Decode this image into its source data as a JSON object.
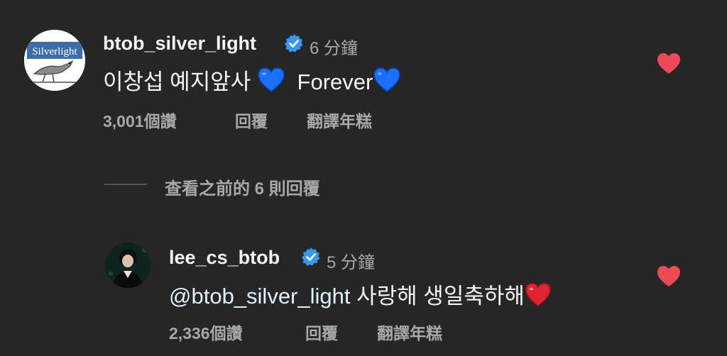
{
  "comment": {
    "avatar_text": "Silverlight",
    "username": "btob_silver_light",
    "time": "6 分鐘",
    "text_part1": "이창섭 예지앞사",
    "text_part2": "Forever",
    "likes": "3,001",
    "likes_label": "個讚",
    "reply_label": "回覆",
    "translate_label": "翻譯年糕",
    "liked": true
  },
  "view_replies": "查看之前的 6 則回覆",
  "reply": {
    "username": "lee_cs_btob",
    "time": "5 分鐘",
    "mention": "@btob_silver_light",
    "text": "사랑해 생일축하해",
    "likes": "2,336",
    "likes_label": "個讚",
    "reply_label": "回覆",
    "translate_label": "翻譯年糕",
    "liked": true
  },
  "colors": {
    "background": "#262626",
    "heart_red": "#ed4956",
    "verified_blue": "#3897f0",
    "blue_heart": "#1b6fff",
    "secondary_text": "#a8a8a8"
  },
  "icons": [
    "verified-badge-icon",
    "like-heart-icon",
    "blue-heart-emoji",
    "red-heart-emoji"
  ]
}
